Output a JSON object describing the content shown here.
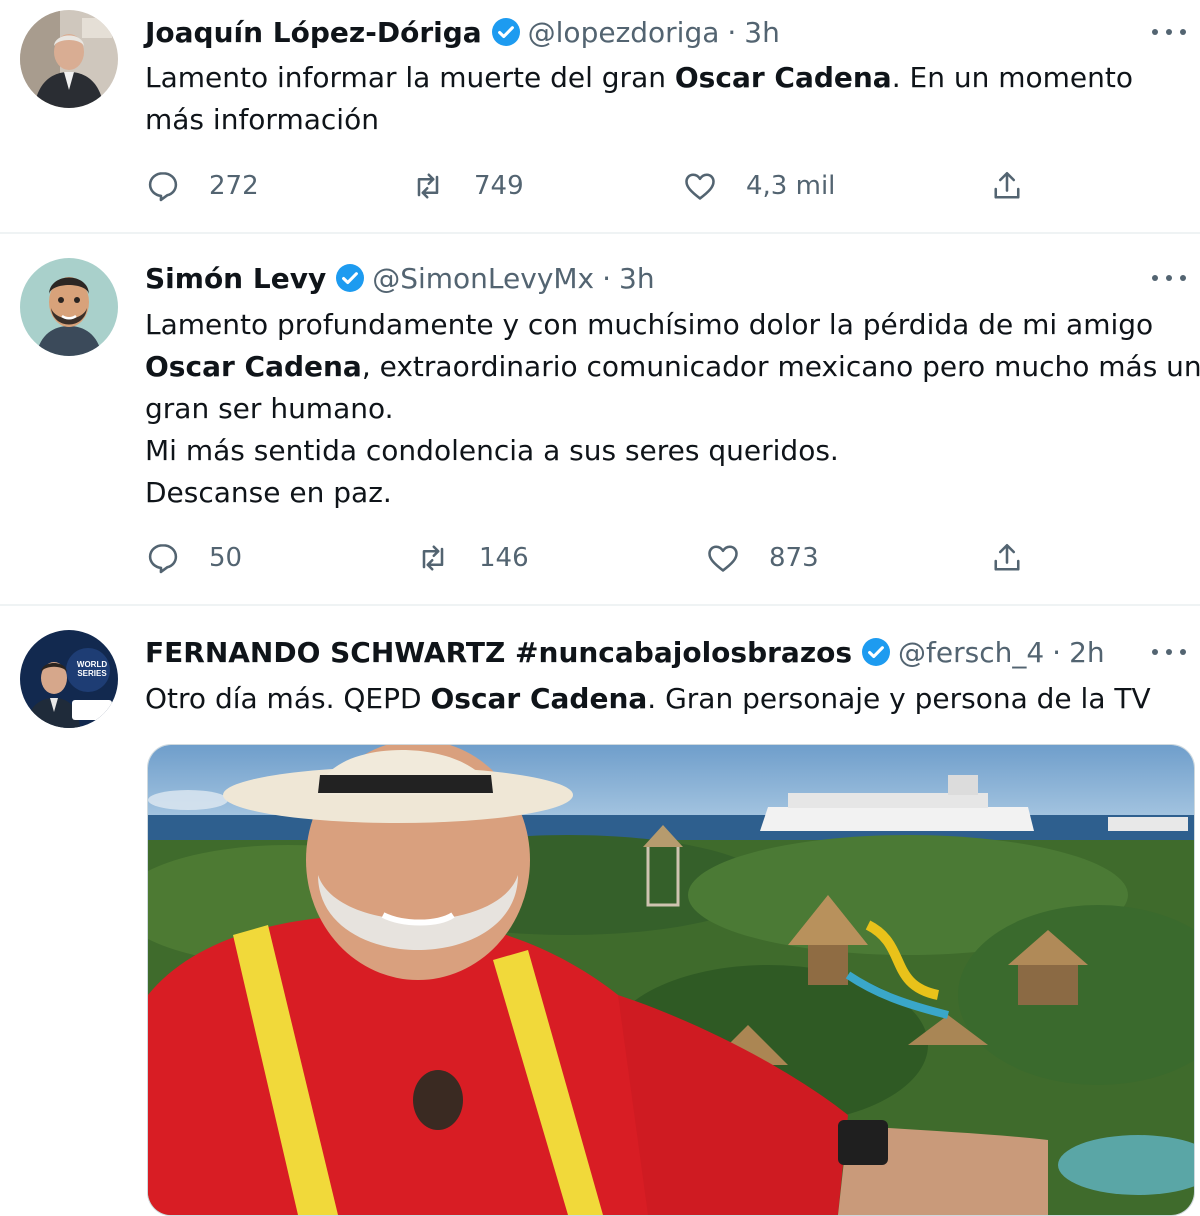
{
  "tweets": [
    {
      "name": "Joaquín López-Dóriga",
      "handle": "@lopezdoriga",
      "time": "3h",
      "lines": [
        [
          "Lamento informar la muerte del gran ",
          "Oscar Cadena",
          ". En un momento"
        ],
        [
          "más información"
        ]
      ],
      "replies": "272",
      "retweets": "749",
      "likes": "4,3 mil"
    },
    {
      "name": "Simón Levy",
      "handle": "@SimonLevyMx",
      "time": "3h",
      "lines": [
        [
          "Lamento profundamente y con muchísimo dolor la pérdida de mi amigo"
        ],
        [
          "",
          "Oscar Cadena",
          ", extraordinario comunicador mexicano pero mucho más un"
        ],
        [
          "gran ser humano."
        ],
        [
          "Mi más sentida condolencia a sus seres queridos."
        ],
        [
          "Descanse en paz."
        ]
      ],
      "replies": "50",
      "retweets": "146",
      "likes": "873"
    },
    {
      "name": "FERNANDO SCHWARTZ #nuncabajolosbrazos",
      "handle": "@fersch_4",
      "time": "2h",
      "lines": [
        [
          "Otro día más. QEPD ",
          "Oscar Cadena",
          ". Gran personaje y persona de la TV"
        ]
      ],
      "avatar_badge_lines": [
        "WORLD",
        "SERIES"
      ]
    }
  ],
  "dot": "·",
  "colors": {
    "verified": "#1d9bf0",
    "secondary": "#536471",
    "separator": "#eff3f4"
  }
}
